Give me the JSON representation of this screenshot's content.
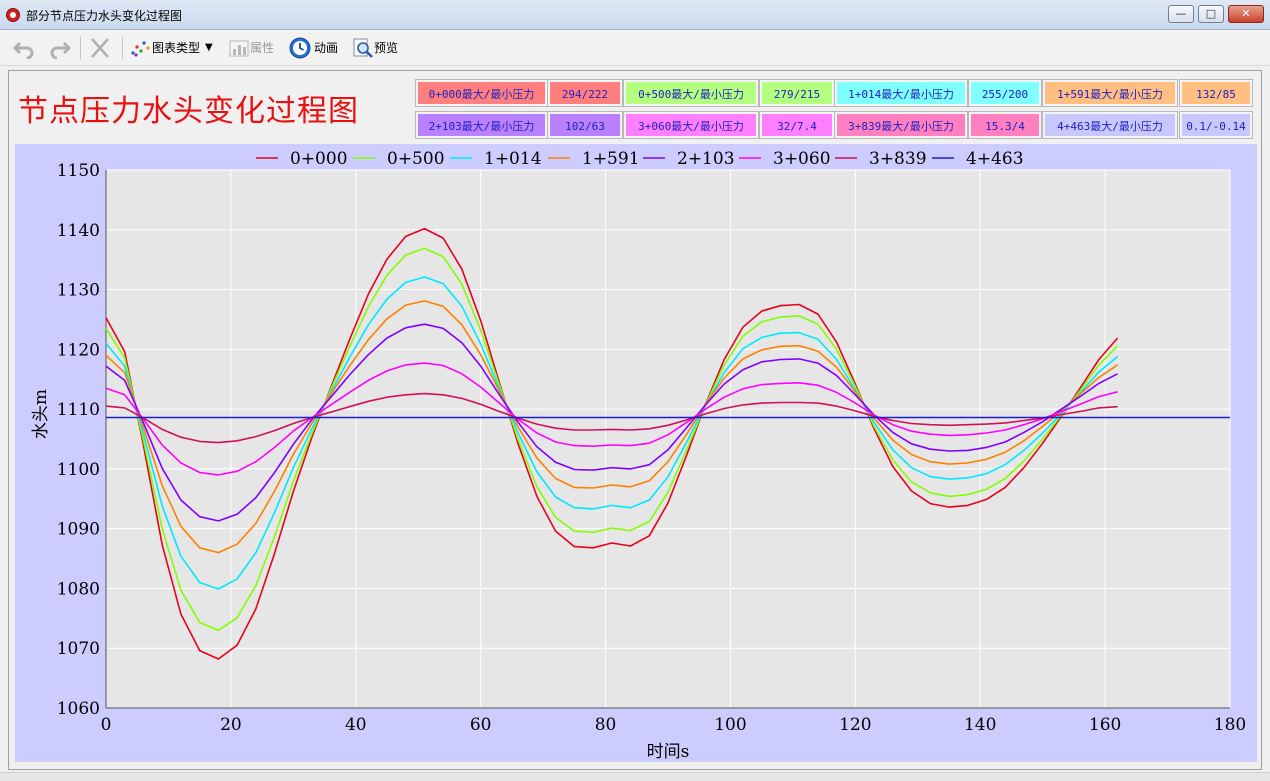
{
  "window": {
    "title": "部分节点压力水头变化过程图"
  },
  "toolbar": {
    "chart_type_label": "图表类型",
    "properties_label": "属性",
    "animation_label": "动画",
    "preview_label": "预览"
  },
  "header": {
    "title": "节点压力水头变化过程图"
  },
  "pressure_table": [
    {
      "label": "0+000最大/最小压力",
      "value": "294/222",
      "color": "#ff7f7f"
    },
    {
      "label": "0+500最大/最小压力",
      "value": "279/215",
      "color": "#b4ff80"
    },
    {
      "label": "1+014最大/最小压力",
      "value": "255/200",
      "color": "#80ffff"
    },
    {
      "label": "1+591最大/最小压力",
      "value": "132/85",
      "color": "#ffbf80"
    },
    {
      "label": "2+103最大/最小压力",
      "value": "102/63",
      "color": "#b980ff"
    },
    {
      "label": "3+060最大/最小压力",
      "value": "32/7.4",
      "color": "#ff80ff"
    },
    {
      "label": "3+839最大/最小压力",
      "value": "15.3/4",
      "color": "#ff80c0"
    },
    {
      "label": "4+463最大/最小压力",
      "value": "0.1/-0.14",
      "color": "#c8c8ff"
    }
  ],
  "chart_data": {
    "type": "line",
    "xlabel": "时间s",
    "ylabel": "水头m",
    "xlim": [
      0,
      180
    ],
    "ylim": [
      1060,
      1150
    ],
    "xticks": [
      0,
      20,
      40,
      60,
      80,
      100,
      120,
      140,
      160,
      180
    ],
    "yticks": [
      1060,
      1070,
      1080,
      1090,
      1100,
      1110,
      1120,
      1130,
      1140,
      1150
    ],
    "grid": true,
    "legend_position": "top",
    "x": [
      0,
      3,
      6,
      9,
      12,
      15,
      18,
      21,
      24,
      27,
      30,
      33,
      36,
      39,
      42,
      45,
      48,
      51,
      54,
      57,
      60,
      63,
      66,
      69,
      72,
      75,
      78,
      81,
      84,
      87,
      90,
      93,
      96,
      99,
      102,
      105,
      108,
      111,
      114,
      117,
      120,
      123,
      126,
      129,
      132,
      135,
      138,
      141,
      144,
      147,
      150,
      153,
      156,
      159,
      162,
      165,
      168,
      171,
      174,
      177,
      180
    ],
    "series": [
      {
        "name": "0+000",
        "color": "#e8001c",
        "values": [
          1125.3,
          1119.6,
          1103.9,
          1087.3,
          1075.7,
          1069.6,
          1068.2,
          1070.5,
          1076.6,
          1085.9,
          1096.2,
          1105.4,
          1113.6,
          1121.6,
          1129.2,
          1135.1,
          1138.9,
          1140.2,
          1138.6,
          1133.4,
          1124.8,
          1114.4,
          1104.2,
          1095.4,
          1089.6,
          1087.0,
          1086.8,
          1087.6,
          1087.1,
          1088.8,
          1094.3,
          1102.3,
          1110.8,
          1118.3,
          1123.7,
          1126.4,
          1127.3,
          1127.5,
          1125.9,
          1121.2,
          1114.2,
          1106.7,
          1100.4,
          1096.3,
          1094.2,
          1093.6,
          1093.9,
          1094.9,
          1096.9,
          1100.2,
          1104.3,
          1108.8,
          1113.5,
          1118.3,
          1121.9
        ]
      },
      {
        "name": "0+500",
        "color": "#80ff00",
        "values": [
          1123.5,
          1118.6,
          1104.7,
          1090.0,
          1079.7,
          1074.3,
          1073.0,
          1075.1,
          1080.5,
          1088.7,
          1097.9,
          1106.0,
          1113.3,
          1120.4,
          1127.1,
          1132.4,
          1135.8,
          1136.9,
          1135.5,
          1130.9,
          1123.2,
          1114.0,
          1104.9,
          1097.0,
          1091.9,
          1089.6,
          1089.4,
          1090.1,
          1089.7,
          1091.2,
          1096.1,
          1103.2,
          1110.7,
          1117.4,
          1122.2,
          1124.6,
          1125.4,
          1125.6,
          1124.2,
          1120.0,
          1113.8,
          1107.1,
          1101.5,
          1097.8,
          1096.0,
          1095.4,
          1095.7,
          1096.6,
          1098.4,
          1101.3,
          1105.0,
          1109.0,
          1113.1,
          1117.4,
          1120.6
        ]
      },
      {
        "name": "1+014",
        "color": "#00e8ff",
        "values": [
          1121.0,
          1117.2,
          1105.9,
          1093.8,
          1085.4,
          1081.0,
          1079.9,
          1081.6,
          1086.0,
          1092.7,
          1100.2,
          1106.8,
          1112.8,
          1118.6,
          1124.1,
          1128.4,
          1131.2,
          1132.1,
          1131.0,
          1127.2,
          1120.9,
          1113.4,
          1106.0,
          1099.5,
          1095.3,
          1093.5,
          1093.3,
          1093.9,
          1093.5,
          1094.8,
          1098.7,
          1104.5,
          1110.7,
          1116.1,
          1120.1,
          1122.0,
          1122.7,
          1122.8,
          1121.7,
          1118.3,
          1113.2,
          1107.8,
          1103.2,
          1100.2,
          1098.7,
          1098.3,
          1098.5,
          1099.2,
          1100.7,
          1103.1,
          1106.0,
          1109.3,
          1112.7,
          1116.2,
          1118.8
        ]
      },
      {
        "name": "1+591",
        "color": "#ff8000",
        "values": [
          1119.0,
          1116.1,
          1106.9,
          1097.2,
          1090.4,
          1086.8,
          1086.0,
          1087.4,
          1090.9,
          1096.3,
          1102.4,
          1107.7,
          1112.5,
          1117.2,
          1121.6,
          1125.1,
          1127.4,
          1128.1,
          1127.2,
          1124.1,
          1119.1,
          1113.0,
          1107.0,
          1101.8,
          1098.4,
          1096.9,
          1096.8,
          1097.3,
          1097.0,
          1098.0,
          1101.2,
          1105.8,
          1110.8,
          1115.2,
          1118.4,
          1119.9,
          1120.5,
          1120.6,
          1119.7,
          1117.0,
          1112.9,
          1108.5,
          1104.8,
          1102.4,
          1101.2,
          1100.8,
          1101.0,
          1101.6,
          1102.8,
          1104.7,
          1107.1,
          1109.7,
          1112.5,
          1115.3,
          1117.4
        ]
      },
      {
        "name": "2+103",
        "color": "#8000ff",
        "values": [
          1117.2,
          1114.8,
          1107.7,
          1100.1,
          1094.8,
          1092.0,
          1091.3,
          1092.4,
          1095.2,
          1099.4,
          1104.1,
          1108.3,
          1112.0,
          1115.7,
          1119.1,
          1121.9,
          1123.6,
          1124.2,
          1123.5,
          1121.1,
          1117.2,
          1112.4,
          1107.8,
          1103.7,
          1101.1,
          1099.9,
          1099.8,
          1100.2,
          1100.0,
          1100.7,
          1103.2,
          1106.9,
          1110.7,
          1114.2,
          1116.6,
          1117.9,
          1118.3,
          1118.4,
          1117.7,
          1115.6,
          1112.4,
          1109.0,
          1106.1,
          1104.2,
          1103.3,
          1103.0,
          1103.1,
          1103.6,
          1104.5,
          1106.1,
          1107.9,
          1110.0,
          1112.1,
          1114.3,
          1115.9
        ]
      },
      {
        "name": "3+060",
        "color": "#ff00ff",
        "values": [
          1113.5,
          1112.4,
          1108.3,
          1104.0,
          1101.0,
          1099.4,
          1099.0,
          1099.6,
          1101.2,
          1103.6,
          1106.3,
          1108.6,
          1110.7,
          1112.8,
          1114.8,
          1116.4,
          1117.4,
          1117.7,
          1117.3,
          1115.9,
          1113.7,
          1111.0,
          1108.3,
          1106.0,
          1104.5,
          1103.9,
          1103.8,
          1104.0,
          1103.9,
          1104.3,
          1105.7,
          1107.8,
          1110.0,
          1112.0,
          1113.4,
          1114.1,
          1114.3,
          1114.4,
          1114.0,
          1112.8,
          1111.0,
          1109.0,
          1107.4,
          1106.3,
          1105.8,
          1105.6,
          1105.7,
          1106.0,
          1106.5,
          1107.4,
          1108.4,
          1109.6,
          1110.8,
          1112.1,
          1112.9
        ]
      },
      {
        "name": "3+839",
        "color": "#d0105a",
        "values": [
          1110.5,
          1110.2,
          1108.5,
          1106.6,
          1105.3,
          1104.6,
          1104.4,
          1104.7,
          1105.4,
          1106.4,
          1107.6,
          1108.6,
          1109.5,
          1110.4,
          1111.3,
          1112.0,
          1112.4,
          1112.6,
          1112.4,
          1111.8,
          1110.8,
          1109.6,
          1108.5,
          1107.5,
          1106.8,
          1106.5,
          1106.5,
          1106.6,
          1106.5,
          1106.7,
          1107.3,
          1108.2,
          1109.2,
          1110.1,
          1110.7,
          1111.0,
          1111.1,
          1111.1,
          1111.0,
          1110.5,
          1109.7,
          1108.8,
          1108.1,
          1107.6,
          1107.4,
          1107.3,
          1107.4,
          1107.5,
          1107.7,
          1108.1,
          1108.5,
          1109.1,
          1109.6,
          1110.2,
          1110.4
        ]
      },
      {
        "name": "4+463",
        "color": "#1c1cd8",
        "values": [
          1108.6,
          1108.6,
          1108.6,
          1108.6,
          1108.6,
          1108.6,
          1108.6,
          1108.6,
          1108.6,
          1108.6,
          1108.6,
          1108.6,
          1108.6,
          1108.6,
          1108.6,
          1108.6,
          1108.6,
          1108.6,
          1108.6,
          1108.6,
          1108.6,
          1108.6,
          1108.6,
          1108.6,
          1108.6,
          1108.6,
          1108.6,
          1108.6,
          1108.6,
          1108.6,
          1108.6,
          1108.6,
          1108.6,
          1108.6,
          1108.6,
          1108.6,
          1108.6,
          1108.6,
          1108.6,
          1108.6,
          1108.6,
          1108.6,
          1108.6,
          1108.6,
          1108.6,
          1108.6,
          1108.6,
          1108.6,
          1108.6,
          1108.6,
          1108.6,
          1108.6,
          1108.6,
          1108.6,
          1108.6,
          1108.6,
          1108.6,
          1108.6,
          1108.6,
          1108.6,
          1108.6
        ]
      }
    ]
  }
}
